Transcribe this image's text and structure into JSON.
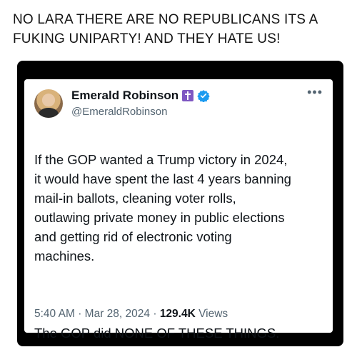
{
  "caption": "NO LARA THERE ARE NO REPUBLICANS ITS A\nFUKING UNIPARTY! AND THEY HATE US!",
  "tweet": {
    "display_name": "Emerald Robinson",
    "handle": "@EmeraldRobinson",
    "badges": [
      "cross-icon",
      "verified-icon"
    ],
    "body_paragraph_1": "If the GOP wanted a Trump victory in 2024,\nit would have spent the last 4 years banning\nmail-in ballots, cleaning voter rolls,\noutlawing private money in public elections\nand getting rid of electronic voting\nmachines.",
    "body_paragraph_2": "The GOP did NONE OF THESE THINGS.",
    "time": "5:40 AM",
    "date": "Mar 28, 2024",
    "separator": "·",
    "views_count": "129.4K",
    "views_label": "Views"
  },
  "colors": {
    "frame": "#000000",
    "card": "#ffffff",
    "verified": "#1d9bf0",
    "cross_badge": "#7e57c2",
    "secondary_text": "#536471"
  }
}
